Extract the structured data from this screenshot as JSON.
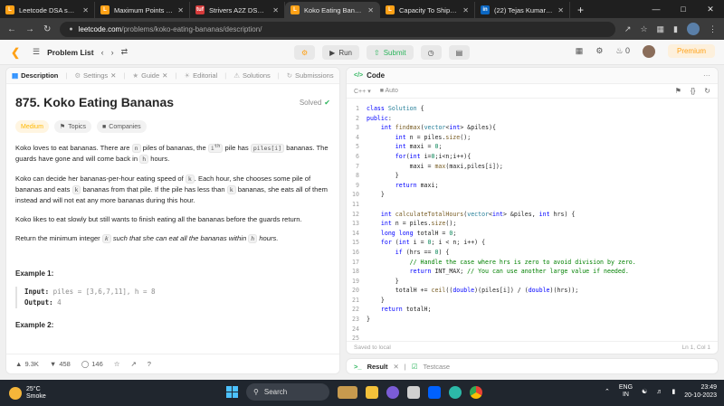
{
  "browser": {
    "tabs": [
      {
        "title": "Leetcode DSA sheet",
        "color": "#ffa116",
        "glyph": "L",
        "active": false
      },
      {
        "title": "Maximum Points You",
        "color": "#ffa116",
        "glyph": "L",
        "active": false
      },
      {
        "title": "Strivers A2Z DSA Co",
        "color": "#d63a3a",
        "glyph": "tuf",
        "active": false
      },
      {
        "title": "Koko Eating Bananas",
        "color": "#ffa116",
        "glyph": "L",
        "active": true
      },
      {
        "title": "Capacity To Ship Pac",
        "color": "#ffa116",
        "glyph": "L",
        "active": false
      },
      {
        "title": "(22) Tejas Kumar | Lin",
        "color": "#0a66c2",
        "glyph": "in",
        "active": false
      }
    ],
    "new_tab": "+",
    "url_host": "leetcode.com",
    "url_path": "/problems/koko-eating-bananas/description/"
  },
  "header": {
    "problem_list": "Problem List",
    "run": "Run",
    "submit": "Submit",
    "streak": "0",
    "premium": "Premium"
  },
  "left": {
    "tabs": [
      {
        "label": "Description",
        "active": true
      },
      {
        "label": "Settings",
        "active": false
      },
      {
        "label": "Guide",
        "active": false
      },
      {
        "label": "Editorial",
        "active": false
      },
      {
        "label": "Solutions",
        "active": false
      },
      {
        "label": "Submissions",
        "active": false
      }
    ],
    "title": "875. Koko Eating Bananas",
    "solved": "Solved",
    "difficulty": "Medium",
    "topics": "Topics",
    "companies": "Companies",
    "p1": {
      "a": "Koko loves to eat bananas. There are ",
      "n": "n",
      "b": " piles of bananas, the ",
      "i": "i",
      "th": "th",
      "c": " pile has ",
      "pi": "piles[i]",
      "d": " bananas. The guards have gone and will come back in ",
      "h": "h",
      "e": " hours."
    },
    "p2": {
      "a": "Koko can decide her bananas-per-hour eating speed of ",
      "k": "k",
      "b": ". Each hour, she chooses some pile of bananas and eats ",
      "c": " bananas from that pile. If the pile has less than ",
      "d": " bananas, she eats all of them instead and will not eat any more bananas during this hour."
    },
    "p3": "Koko likes to eat slowly but still wants to finish eating all the bananas before the guards return.",
    "p4": {
      "a": "Return the minimum integer ",
      "k": "k",
      "b": " such that she can eat all the bananas within ",
      "h": "h",
      "c": " hours."
    },
    "example1_title": "Example 1:",
    "ex1_input_label": "Input:",
    "ex1_input": "piles = [3,6,7,11], h = 8",
    "ex1_output_label": "Output:",
    "ex1_output": "4",
    "example2_title": "Example 2:",
    "likes": "9.3K",
    "dislikes": "458",
    "comments": "146"
  },
  "right": {
    "header": "Code",
    "language": "C++",
    "auto": "Auto",
    "saved": "Saved to local",
    "cursor": "Ln 1, Col 1",
    "result_tab": "Result",
    "testcase_tab": "Testcase"
  },
  "taskbar": {
    "temp": "25°C",
    "weather": "Smoke",
    "search": "Search",
    "lang1": "ENG",
    "lang2": "IN",
    "time": "23:49",
    "date": "20-10-2023"
  }
}
